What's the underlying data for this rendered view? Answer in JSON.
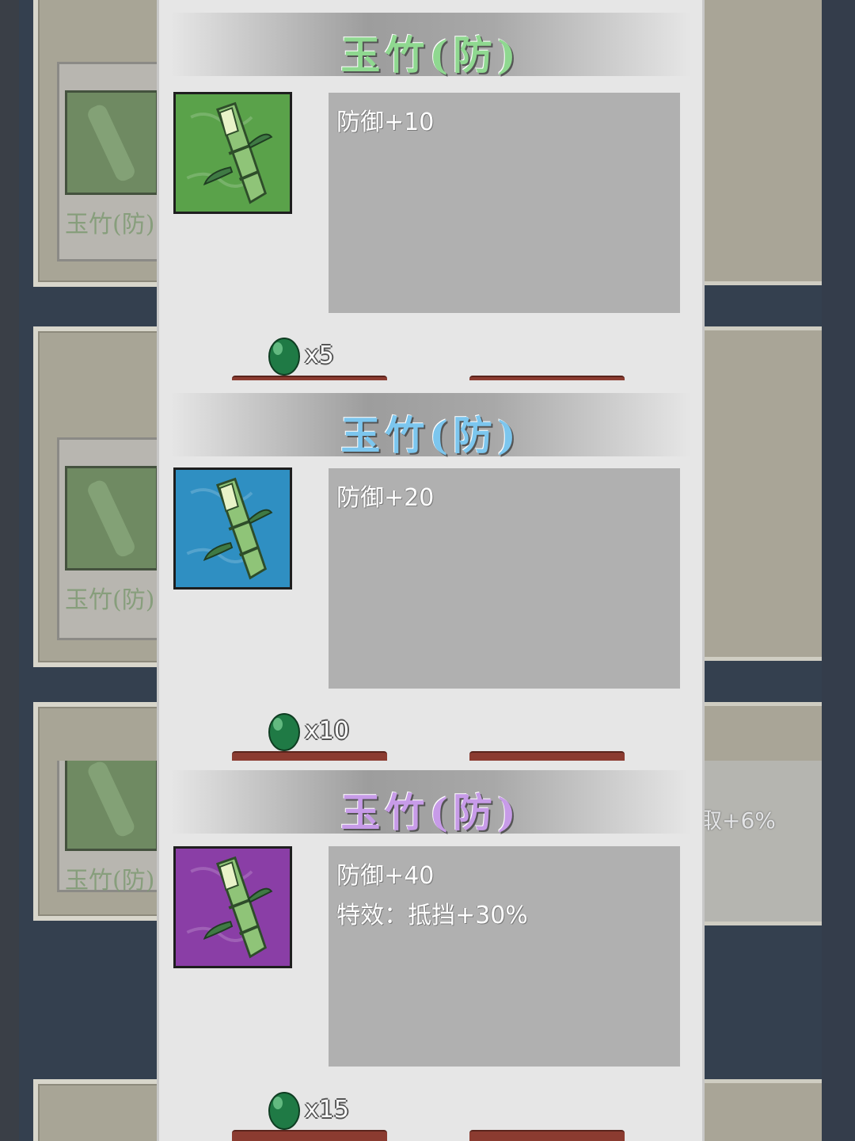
{
  "popups": [
    {
      "title": "玉竹(防)",
      "title_color": "#8fd890",
      "icon_bg": "#5aa24a",
      "icon_name": "bamboo-icon",
      "stats": [
        "防御+10"
      ],
      "cost": "x5"
    },
    {
      "title": "玉竹(防)",
      "title_color": "#7cc6ee",
      "icon_bg": "#2f8fc2",
      "icon_name": "bamboo-icon",
      "stats": [
        "防御+20"
      ],
      "cost": "x10"
    },
    {
      "title": "玉竹(防)",
      "title_color": "#c79be8",
      "icon_bg": "#8a3ea6",
      "icon_name": "bamboo-icon",
      "stats": [
        "防御+40",
        "特效：抵挡+30%"
      ],
      "cost": "x15"
    }
  ],
  "background": {
    "item_label": "玉竹(防)",
    "right_text": "取+6%"
  },
  "currency_icon": "jade-gem-icon"
}
